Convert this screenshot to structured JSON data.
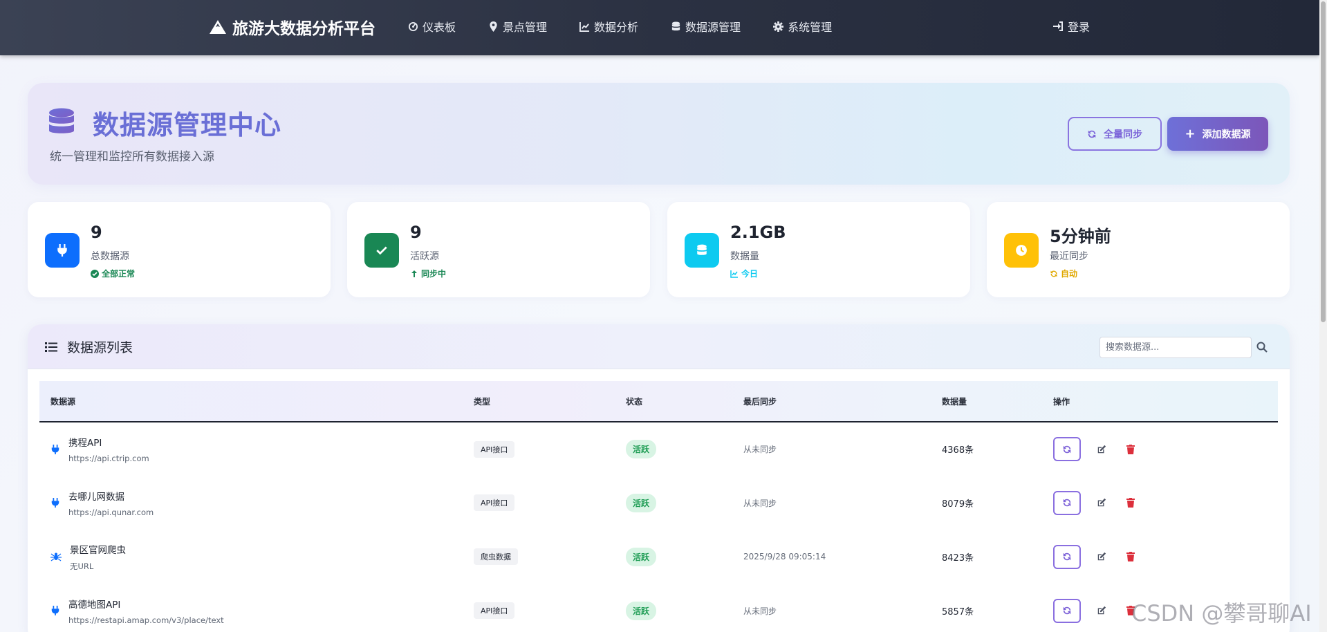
{
  "nav": {
    "brand": "旅游大数据分析平台",
    "items": [
      {
        "label": "仪表板",
        "icon": "dashboard-icon"
      },
      {
        "label": "景点管理",
        "icon": "map-marker-icon"
      },
      {
        "label": "数据分析",
        "icon": "line-chart-icon"
      },
      {
        "label": "数据源管理",
        "icon": "database-icon"
      },
      {
        "label": "系统管理",
        "icon": "gear-icon"
      }
    ],
    "login": "登录"
  },
  "hero": {
    "title": "数据源管理中心",
    "subtitle": "统一管理和监控所有数据接入源",
    "sync_all": "全量同步",
    "add_source": "添加数据源"
  },
  "stats": [
    {
      "value": "9",
      "label": "总数据源",
      "note": "全部正常",
      "color": "#0d6efd",
      "note_color": "#198754"
    },
    {
      "value": "9",
      "label": "活跃源",
      "note": "同步中",
      "color": "#198754",
      "note_color": "#198754"
    },
    {
      "value": "2.1GB",
      "label": "数据量",
      "note": "今日",
      "color": "#0dcaf0",
      "note_color": "#0dcaf0"
    },
    {
      "value": "5分钟前",
      "label": "最近同步",
      "note": "自动",
      "color": "#ffc107",
      "note_color": "#e0a800"
    }
  ],
  "list": {
    "title": "数据源列表",
    "search_placeholder": "搜索数据源...",
    "columns": [
      "数据源",
      "类型",
      "状态",
      "最后同步",
      "数据量",
      "操作"
    ],
    "rows": [
      {
        "name": "携程API",
        "url": "https://api.ctrip.com",
        "type": "API接口",
        "status": "活跃",
        "last_sync": "从未同步",
        "amount": "4368条",
        "icon": "plug-icon"
      },
      {
        "name": "去哪儿网数据",
        "url": "https://api.qunar.com",
        "type": "API接口",
        "status": "活跃",
        "last_sync": "从未同步",
        "amount": "8079条",
        "icon": "plug-icon"
      },
      {
        "name": "景区官网爬虫",
        "url": "无URL",
        "type": "爬虫数据",
        "status": "活跃",
        "last_sync": "2025/9/28 09:05:14",
        "amount": "8423条",
        "icon": "spider-icon"
      },
      {
        "name": "高德地图API",
        "url": "https://restapi.amap.com/v3/place/text",
        "type": "API接口",
        "status": "活跃",
        "last_sync": "从未同步",
        "amount": "5857条",
        "icon": "plug-icon"
      }
    ]
  },
  "watermark": "CSDN @攀哥聊AI"
}
